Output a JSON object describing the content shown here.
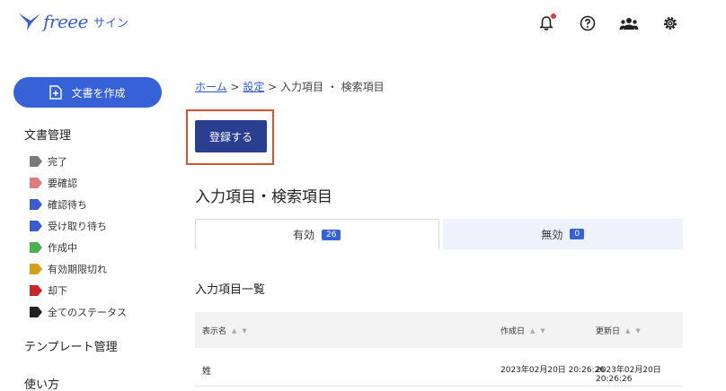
{
  "header": {
    "logo_text": "freee",
    "logo_sub": "サイン",
    "icons": [
      "bell-icon",
      "help-icon",
      "users-icon",
      "gear-icon"
    ]
  },
  "sidebar": {
    "create_label": "文書を作成",
    "doc_mgmt_label": "文書管理",
    "statuses": [
      {
        "label": "完了",
        "color": "#7a7a7a"
      },
      {
        "label": "要確認",
        "color": "#e07b7b"
      },
      {
        "label": "確認待ち",
        "color": "#3b5bd0"
      },
      {
        "label": "受け取り待ち",
        "color": "#3b5bd0"
      },
      {
        "label": "作成中",
        "color": "#4caf50"
      },
      {
        "label": "有効期限切れ",
        "color": "#d4a017"
      },
      {
        "label": "却下",
        "color": "#c62828"
      },
      {
        "label": "全てのステータス",
        "color": "#222222"
      }
    ],
    "template_label": "テンプレート管理",
    "howto_label": "使い方"
  },
  "breadcrumb": {
    "home": "ホーム",
    "sep": " > ",
    "settings": "設定",
    "current": "入力項目 ・ 検索項目"
  },
  "register_label": "登録する",
  "page_title": "入力項目・検索項目",
  "tabs": [
    {
      "label": "有効",
      "count": "26"
    },
    {
      "label": "無効",
      "count": "0"
    }
  ],
  "list_title": "入力項目一覧",
  "table": {
    "columns": [
      "表示名",
      "作成日",
      "更新日"
    ],
    "rows": [
      {
        "name": "姓",
        "created": "2023年02月20日 20:26:26",
        "updated": "2023年02月20日 20:26:26"
      }
    ]
  },
  "colors": {
    "accent": "#3761d6",
    "register": "#2a3f8f",
    "highlight": "#d9532b"
  }
}
